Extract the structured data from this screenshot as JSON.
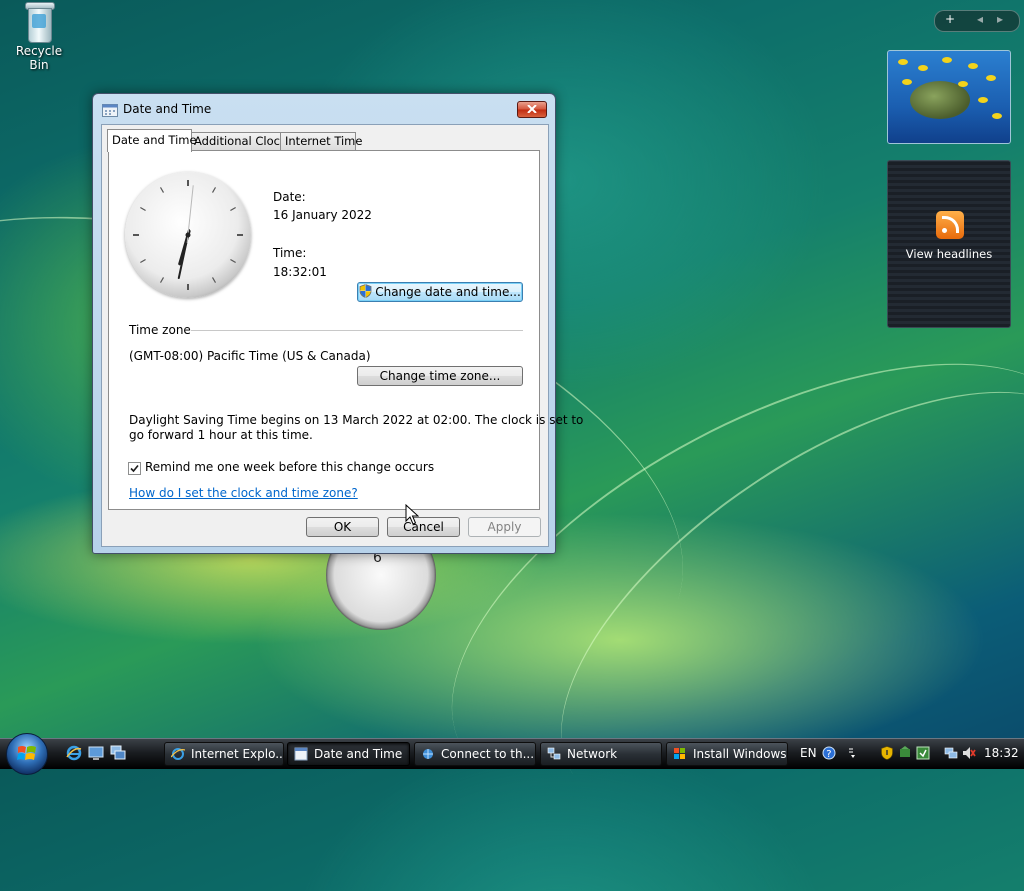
{
  "desktop": {
    "recycle_bin_label": "Recycle Bin"
  },
  "sidebar": {
    "controls": {
      "add": "+",
      "prev": "◂",
      "next": "▸"
    },
    "feed_label": "View headlines"
  },
  "background_clock": {
    "visible_numeral": "6"
  },
  "dialog": {
    "title": "Date and Time",
    "tabs": [
      {
        "label": "Date and Time",
        "active": true
      },
      {
        "label": "Additional Clocks",
        "active": false
      },
      {
        "label": "Internet Time",
        "active": false
      }
    ],
    "clock": {
      "hour": 18,
      "minute": 32,
      "second": 1
    },
    "date_label": "Date:",
    "date_value": "16 January 2022",
    "time_label": "Time:",
    "time_value": "18:32:01",
    "change_datetime_button": "Change date and time...",
    "timezone_heading": "Time zone",
    "timezone_value": "(GMT-08:00) Pacific Time (US & Canada)",
    "change_timezone_button": "Change time zone...",
    "dst_line1": "Daylight Saving Time begins on 13 March 2022 at 02:00. The clock is set to",
    "dst_line2": "go forward 1 hour at this time.",
    "remind_checkbox": {
      "label": "Remind me one week before this change occurs",
      "checked": true
    },
    "help_link": "How do I set the clock and time zone?",
    "ok_button": "OK",
    "cancel_button": "Cancel",
    "apply_button": "Apply"
  },
  "taskbar": {
    "tasks": [
      {
        "label": "Internet Explo...",
        "icon": "internet-explorer-icon",
        "active": false
      },
      {
        "label": "Date and Time",
        "icon": "clock-icon",
        "active": true
      },
      {
        "label": "Connect to th...",
        "icon": "network-connect-icon",
        "active": false
      },
      {
        "label": "Network",
        "icon": "network-icon",
        "active": false
      },
      {
        "label": "Install Windows",
        "icon": "windows-installer-icon",
        "active": false
      }
    ],
    "language": "EN",
    "clock": "18:32"
  },
  "colors": {
    "accent": "#3c7fb1",
    "link": "#0066cc",
    "close_button": "#c02a10"
  }
}
